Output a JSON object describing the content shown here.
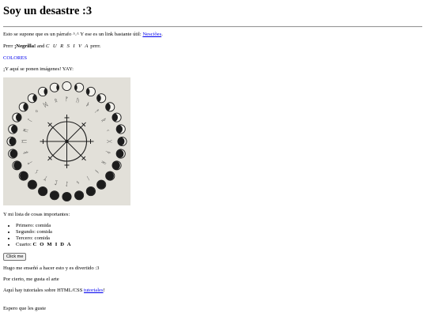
{
  "page": {
    "title": "Soy un desastre :3"
  },
  "para1": {
    "text": "Esto se supone que es un párrafo ^.^ Y ese es un link bastante útil: ",
    "link": "Nesciões",
    "after": "."
  },
  "para2": {
    "pre": "Prrrr ",
    "bold": "¡Negrilla!",
    "mid": " and ",
    "italic": "C U R S I V A",
    "post": " prrrr."
  },
  "colores": "COLORES",
  "para3": "¡Y aquí se ponen imágenes! YAY:",
  "list_intro": "Y mi lista de cosas importantes:",
  "list": {
    "items": [
      "Primero: comida",
      "Segundo: comida",
      "Tercero: comida"
    ],
    "last_prefix": "Cuarto: ",
    "last_bold": "C O M I D A"
  },
  "button_label": "Click me",
  "para4": "Hugo me enseñó a hacer esto y es divertido :3",
  "para5": "Por cierto, me gusta el arte",
  "para6": {
    "text": "Aquí hay tutoriales sobre HTML/CSS ",
    "link": "tutoriales",
    "after": "!"
  },
  "para7": "Espero que les guste",
  "colors": {
    "link": "#0000ee",
    "image_bg": "#e2e0d9",
    "ink": "#1c1c1c"
  }
}
